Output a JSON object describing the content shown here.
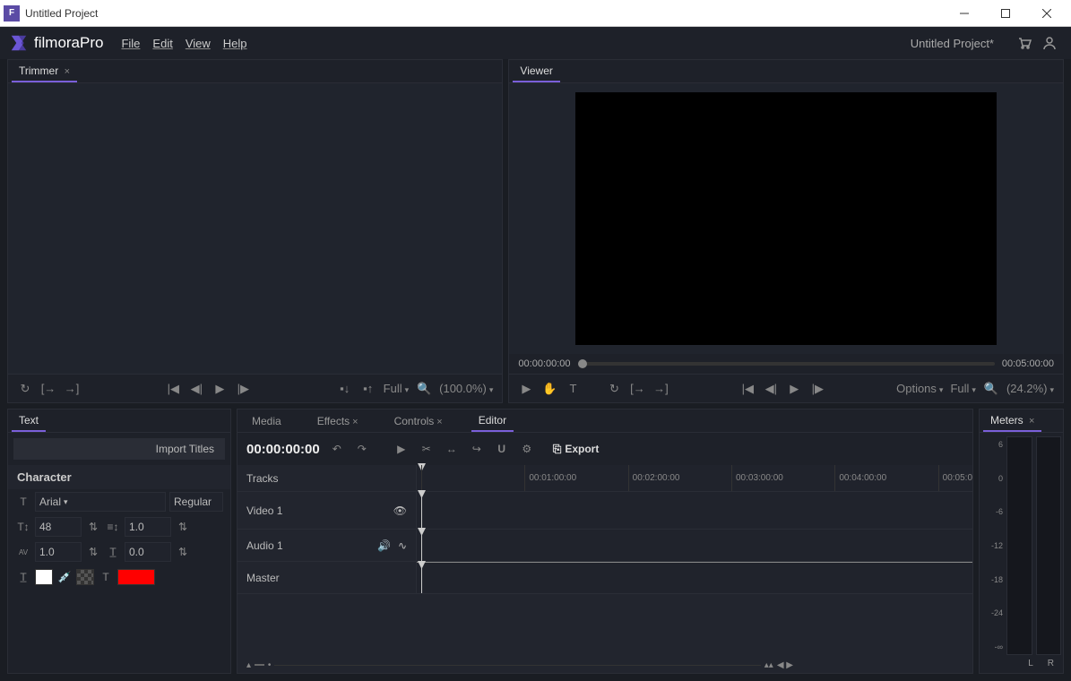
{
  "titlebar": {
    "title": "Untitled Project"
  },
  "menubar": {
    "logo": "filmoraPro",
    "items": [
      "File",
      "Edit",
      "View",
      "Help"
    ],
    "project": "Untitled Project*"
  },
  "trimmer": {
    "tab": "Trimmer",
    "resolution": "Full",
    "zoom": "(100.0%)"
  },
  "viewer": {
    "tab": "Viewer",
    "time_start": "00:00:00:00",
    "time_end": "00:05:00:00",
    "options": "Options",
    "resolution": "Full",
    "zoom": "(24.2%)"
  },
  "text_panel": {
    "tab": "Text",
    "import": "Import Titles",
    "section": "Character",
    "font": "Arial",
    "weight": "Regular",
    "size": "48",
    "leading": "1.0",
    "tracking": "1.0",
    "baseline": "0.0"
  },
  "editor": {
    "tabs": [
      "Media",
      "Effects",
      "Controls",
      "Editor"
    ],
    "timecode": "00:00:00:00",
    "export": "Export",
    "tracks_label": "Tracks",
    "ruler": [
      "00:01:00:00",
      "00:02:00:00",
      "00:03:00:00",
      "00:04:00:00",
      "00:05:0"
    ],
    "video_track": "Video 1",
    "audio_track": "Audio 1",
    "master_track": "Master"
  },
  "meters": {
    "tab": "Meters",
    "scale": [
      "6",
      "0",
      "-6",
      "-12",
      "-18",
      "-24",
      "-∞"
    ],
    "left": "L",
    "right": "R"
  }
}
